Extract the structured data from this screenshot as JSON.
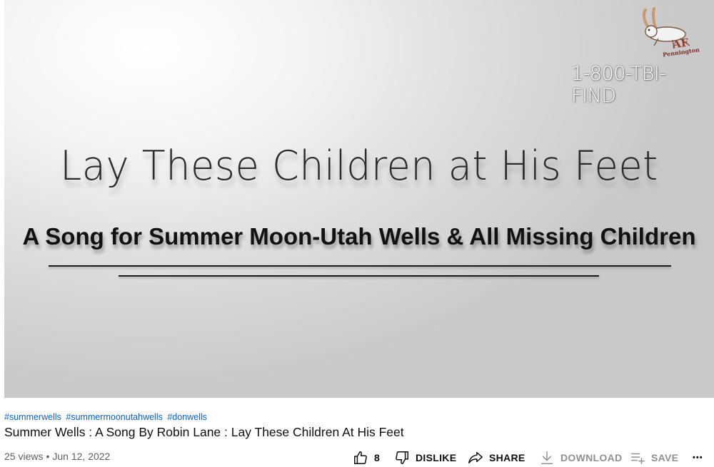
{
  "video": {
    "title_main": "Lay These Children at His Feet",
    "subtitle": "A Song for Summer Moon-Utah Wells & All Missing Children",
    "watermark": {
      "logo_text": "AF",
      "logo_subtext": "Pennington",
      "phone": "1-800-TBI-FIND"
    }
  },
  "hashtags": [
    "#summerwells",
    "#summermoonutahwells",
    "#donwells"
  ],
  "title": "Summer Wells : A Song By Robin Lane : Lay These Children At His Feet",
  "meta": {
    "views": "25 views",
    "separator": "•",
    "date": "Jun 12, 2022"
  },
  "actions": {
    "like_count": "8",
    "dislike_label": "DISLIKE",
    "share_label": "SHARE",
    "download_label": "DOWNLOAD",
    "save_label": "SAVE",
    "more_label": "•••"
  },
  "colors": {
    "link": "#065fd4",
    "meta_text": "#606060",
    "disabled": "#909090"
  }
}
